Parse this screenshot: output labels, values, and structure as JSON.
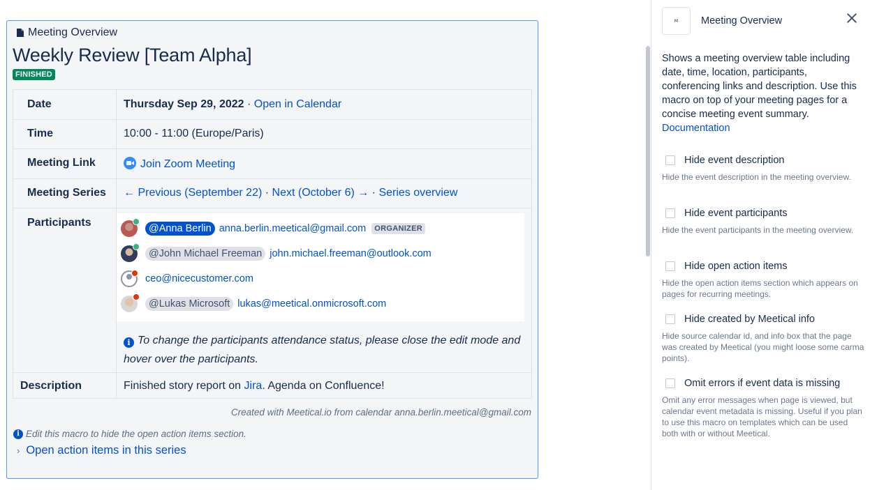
{
  "macro": {
    "header": "Meeting Overview",
    "title": "Weekly Review [Team Alpha]",
    "status": "FINISHED",
    "rows": {
      "date_label": "Date",
      "date_value": "Thursday Sep 29, 2022",
      "date_sep": " · ",
      "calendar_link": "Open in Calendar",
      "time_label": "Time",
      "time_value": "10:00 - 11:00 (Europe/Paris)",
      "link_label": "Meeting Link",
      "zoom_link": "Join Zoom Meeting",
      "series_label": "Meeting Series",
      "prev_link": "← Previous (September 22)",
      "sep1": " · ",
      "next_link": "Next (October 6) →",
      "sep2": " · ",
      "series_link": "Series overview",
      "participants_label": "Participants",
      "description_label": "Description",
      "desc_prefix": "Finished story report on ",
      "desc_link": "Jira",
      "desc_suffix": ". Agenda on Confluence!"
    },
    "participants": [
      {
        "mention": "@Anna Berlin",
        "email": "anna.berlin.meetical@gmail.com",
        "badge": "ORGANIZER",
        "status": "accepted"
      },
      {
        "mention": "@John Michael Freeman",
        "email": "john.michael.freeman@outlook.com",
        "status": "accepted"
      },
      {
        "email": "ceo@nicecustomer.com",
        "status": "declined"
      },
      {
        "mention": "@Lukas Microsoft",
        "email": "lukas@meetical.onmicrosoft.com",
        "status": "declined"
      }
    ],
    "participants_hint": "To change the participants attendance status, please close the edit mode and hover over the participants.",
    "created_note": "Created with Meetical.io from calendar anna.berlin.meetical@gmail.com",
    "edit_note": "Edit this macro to hide the open action items section.",
    "open_items": "Open action items in this series"
  },
  "sidebar": {
    "logo_text": "M",
    "title": "Meeting Overview",
    "description": "Shows a meeting overview table including date, time, location, participants, conferencing links and description. Use this macro on top of your meeting pages for a concise meeting event summary.",
    "doc_link": "Documentation",
    "options": [
      {
        "label": "Hide event description",
        "help": "Hide the event description in the meeting overview."
      },
      {
        "label": "Hide event participants",
        "help": "Hide the event participants in the meeting overview."
      },
      {
        "label": "Hide open action items",
        "help": "Hide the open action items section which appears on pages for recurring meetings."
      },
      {
        "label": "Hide created by Meetical info",
        "help": "Hide source calendar id, and info box that the page was created by Meetical (you might loose some carma points)."
      },
      {
        "label": "Omit errors if event data is missing",
        "help": "Omit any error messages when page is viewed, but calendar event metadata is missing. Useful if you plan to use this macro on templates which can be used both with or without Meetical."
      }
    ]
  },
  "colors": {
    "accent": "#0052cc",
    "finished": "#00875a",
    "accepted": "#36b37e",
    "declined": "#de350b"
  }
}
